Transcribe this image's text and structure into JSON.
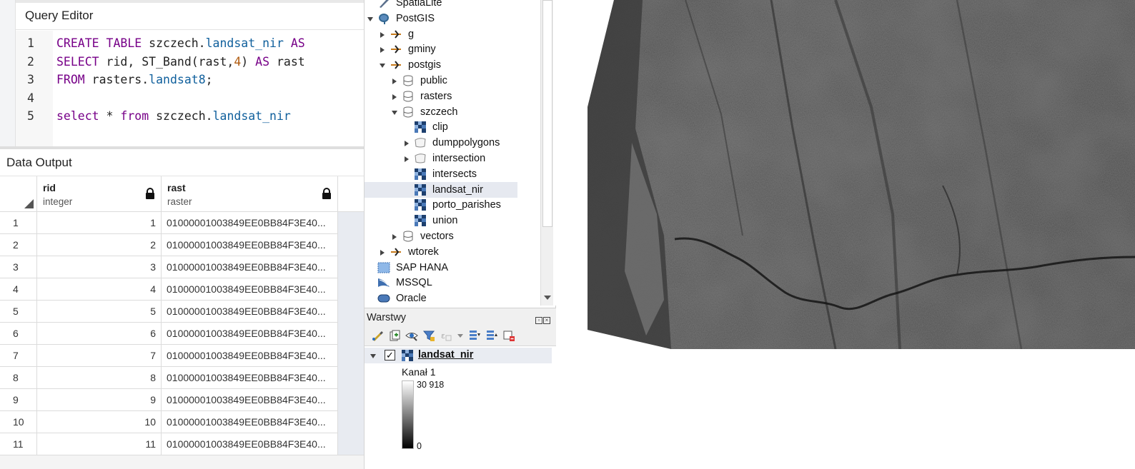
{
  "pgadmin": {
    "query_editor_title": "Query Editor",
    "code_lines": [
      {
        "num": "1",
        "tokens": [
          {
            "t": "CREATE TABLE ",
            "c": "kw"
          },
          {
            "t": "szczech.",
            "c": "nm"
          },
          {
            "t": "landsat_nir ",
            "c": "pr"
          },
          {
            "t": "AS",
            "c": "kw"
          }
        ]
      },
      {
        "num": "2",
        "tokens": [
          {
            "t": "SELECT ",
            "c": "kw"
          },
          {
            "t": "rid, ST_Band(rast,",
            "c": "nm"
          },
          {
            "t": "4",
            "c": "num"
          },
          {
            "t": ") ",
            "c": "nm"
          },
          {
            "t": "AS ",
            "c": "kw"
          },
          {
            "t": "rast",
            "c": "nm"
          }
        ]
      },
      {
        "num": "3",
        "tokens": [
          {
            "t": "FROM ",
            "c": "kw"
          },
          {
            "t": "rasters.",
            "c": "nm"
          },
          {
            "t": "landsat8",
            "c": "pr"
          },
          {
            "t": ";",
            "c": "nm"
          }
        ]
      },
      {
        "num": "4",
        "tokens": []
      },
      {
        "num": "5",
        "tokens": [
          {
            "t": "select ",
            "c": "kw"
          },
          {
            "t": "* ",
            "c": "nm"
          },
          {
            "t": "from ",
            "c": "kw"
          },
          {
            "t": "szczech.",
            "c": "nm"
          },
          {
            "t": "landsat_nir",
            "c": "pr"
          }
        ]
      }
    ],
    "data_output_title": "Data Output",
    "columns": [
      {
        "name": "rid",
        "type": "integer"
      },
      {
        "name": "rast",
        "type": "raster"
      }
    ],
    "rows": [
      {
        "n": "1",
        "rid": "1",
        "rast": "01000001003849EE0BB84F3E40..."
      },
      {
        "n": "2",
        "rid": "2",
        "rast": "01000001003849EE0BB84F3E40..."
      },
      {
        "n": "3",
        "rid": "3",
        "rast": "01000001003849EE0BB84F3E40..."
      },
      {
        "n": "4",
        "rid": "4",
        "rast": "01000001003849EE0BB84F3E40..."
      },
      {
        "n": "5",
        "rid": "5",
        "rast": "01000001003849EE0BB84F3E40..."
      },
      {
        "n": "6",
        "rid": "6",
        "rast": "01000001003849EE0BB84F3E40..."
      },
      {
        "n": "7",
        "rid": "7",
        "rast": "01000001003849EE0BB84F3E40..."
      },
      {
        "n": "8",
        "rid": "8",
        "rast": "01000001003849EE0BB84F3E40..."
      },
      {
        "n": "9",
        "rid": "9",
        "rast": "01000001003849EE0BB84F3E40..."
      },
      {
        "n": "10",
        "rid": "10",
        "rast": "01000001003849EE0BB84F3E40..."
      },
      {
        "n": "11",
        "rid": "11",
        "rast": "01000001003849EE0BB84F3E40..."
      }
    ]
  },
  "browser": {
    "items": [
      {
        "label": "SpatiaLite",
        "icon": "spatialite-icon",
        "arrow": "none"
      },
      {
        "label": "PostGIS",
        "icon": "postgis-elephant-icon",
        "arrow": "down"
      },
      {
        "label": "g",
        "icon": "connection-icon",
        "arrow": "right"
      },
      {
        "label": "gminy",
        "icon": "connection-icon",
        "arrow": "right"
      },
      {
        "label": "postgis",
        "icon": "connection-icon",
        "arrow": "down"
      },
      {
        "label": "public",
        "icon": "schema-icon",
        "arrow": "right"
      },
      {
        "label": "rasters",
        "icon": "schema-icon",
        "arrow": "right"
      },
      {
        "label": "szczech",
        "icon": "schema-icon",
        "arrow": "down"
      },
      {
        "label": "clip",
        "icon": "raster-layer-icon",
        "arrow": "none"
      },
      {
        "label": "dumppolygons",
        "icon": "polygon-layer-icon",
        "arrow": "right"
      },
      {
        "label": "intersection",
        "icon": "polygon-layer-icon",
        "arrow": "right"
      },
      {
        "label": "intersects",
        "icon": "raster-layer-icon",
        "arrow": "none"
      },
      {
        "label": "landsat_nir",
        "icon": "raster-layer-icon",
        "arrow": "none",
        "selected": true
      },
      {
        "label": "porto_parishes",
        "icon": "raster-layer-icon",
        "arrow": "none"
      },
      {
        "label": "union",
        "icon": "raster-layer-icon",
        "arrow": "none"
      },
      {
        "label": "vectors",
        "icon": "schema-icon",
        "arrow": "right"
      },
      {
        "label": "wtorek",
        "icon": "connection-icon",
        "arrow": "right"
      },
      {
        "label": "SAP HANA",
        "icon": "sap-hana-icon",
        "arrow": "none"
      },
      {
        "label": "MSSQL",
        "icon": "mssql-icon",
        "arrow": "none"
      },
      {
        "label": "Oracle",
        "icon": "oracle-icon",
        "arrow": "none"
      }
    ]
  },
  "layers": {
    "title": "Warstwy",
    "layer_name": "landsat_nir",
    "check": "✓",
    "band_label": "Kanał 1",
    "ramp_max": "30 918",
    "ramp_min": "0",
    "toolbar_icons": [
      "style-icon",
      "add-group-icon",
      "eye-icon",
      "filter-icon",
      "expression-icon",
      "dropdown-icon",
      "expand-all-icon",
      "collapse-all-icon",
      "remove-layer-icon"
    ]
  },
  "colors": {
    "keyword": "#770088",
    "property": "#0f5f9c",
    "number": "#b15c10",
    "postgis_blue": "#336791",
    "connection_orange": "#c77a1a"
  }
}
